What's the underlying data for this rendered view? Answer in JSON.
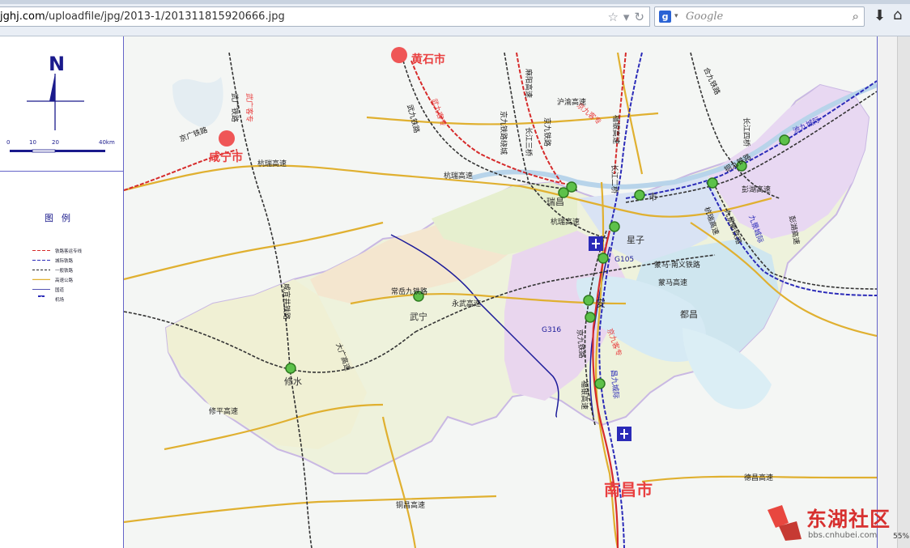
{
  "browser": {
    "url_prefix": "jghj.com",
    "url_rest": "/uploadfile/jpg/2013-1/201311815920666.jpg",
    "search_placeholder": "Google",
    "zoom": "55%"
  },
  "legend": {
    "north": "N",
    "scale": [
      "0",
      "10",
      "20",
      "40km"
    ],
    "title": "图例",
    "items": [
      {
        "label": "铁路客运专线",
        "color": "#d62b2b"
      },
      {
        "label": "城际铁路",
        "color": "#2b2bb8"
      },
      {
        "label": "一般铁路",
        "color": "#222222"
      },
      {
        "label": "高速公路",
        "color": "#e0b030"
      },
      {
        "label": "国道",
        "color": "#1c1c9a"
      },
      {
        "label": "机场",
        "color": "#2b2bb8"
      }
    ]
  },
  "map": {
    "cities": {
      "huangshi": "黄石市",
      "xianning": "咸宁市",
      "nanchang": "南昌市"
    },
    "counties": {
      "ruichang": "瑞昌",
      "jiujiang_city": "市",
      "xingzi": "星子",
      "de_an": "安",
      "wuning": "武宁",
      "duchang": "都昌",
      "xiushui": "修水"
    },
    "road_labels": {
      "wuguang_rail": "武广铁路",
      "wuguang_pdl": "武广客专",
      "jingguang_rail": "京广铁路",
      "hangrui_1": "杭瑞高速",
      "hangrui_2": "杭瑞高速",
      "hangrui_3": "杭瑞高速",
      "hangrui_4": "杭瑞高速",
      "wujiu_rail": "武九铁路",
      "wujiu_pdl": "武九客专",
      "mahe_hwy": "麻阳高速",
      "jingjiu_rail_1": "京九铁路",
      "jingjiu_rail_2": "京九铁路",
      "jingjiu_rail_3": "京九铁路绕城",
      "jingjiu_pdl_1": "京九客专",
      "jingjiu_pdl_2": "京九客专",
      "hukun": "沪渝高速",
      "yangtze_3": "长江三桥",
      "yangtze_2": "长江二桥",
      "fuyin_1": "福银高速",
      "fuyin_2": "福银高速",
      "hejiu": "合九铁路",
      "yangtze_4": "长江四桥",
      "tongjiu": "铜九铁路",
      "chijiu": "池九城际",
      "pengshu": "彭湖高速",
      "jiujing": "九景城际",
      "jiujing_rail": "九景衢铁路",
      "peng_hwy": "彭湖高速",
      "g105": "G105",
      "g316": "G316",
      "mayi_rail": "蒙马·南义铁路",
      "chengjiu": "常岳九铁路",
      "yongwu": "永武高速",
      "xianyi_rail": "咸宜井铁路",
      "daguang": "大广高速",
      "xiuping": "修平高速",
      "changjiu": "昌九城际",
      "tongchang": "铜昌高速",
      "dechang": "德昌高速",
      "mama_hwy": "蒙马高速"
    }
  }
}
